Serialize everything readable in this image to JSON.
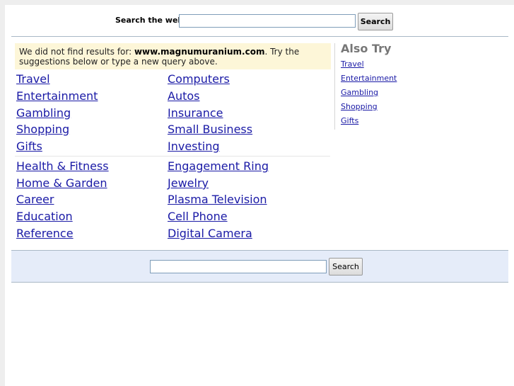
{
  "top_search": {
    "label": "Search the web:",
    "input_value": "",
    "button_label": "Search"
  },
  "notice": {
    "prefix": "We did not find results for: ",
    "domain": "www.magnumuranium.com",
    "suffix": ". Try the suggestions below or type a new query above."
  },
  "categories": {
    "group1_left": [
      "Travel",
      "Entertainment",
      "Gambling",
      "Shopping",
      "Gifts"
    ],
    "group1_right": [
      "Computers",
      "Autos",
      "Insurance",
      "Small Business",
      "Investing"
    ],
    "group2_left": [
      "Health & Fitness",
      "Home & Garden",
      "Career",
      "Education",
      "Reference"
    ],
    "group2_right": [
      "Engagement Ring",
      "Jewelry",
      "Plasma Television",
      "Cell Phone",
      "Digital Camera"
    ]
  },
  "also_try": {
    "title": "Also Try",
    "links": [
      "Travel",
      "Entertainment",
      "Gambling",
      "Shopping",
      "Gifts"
    ]
  },
  "bottom_search": {
    "input_value": "",
    "button_label": "Search"
  }
}
